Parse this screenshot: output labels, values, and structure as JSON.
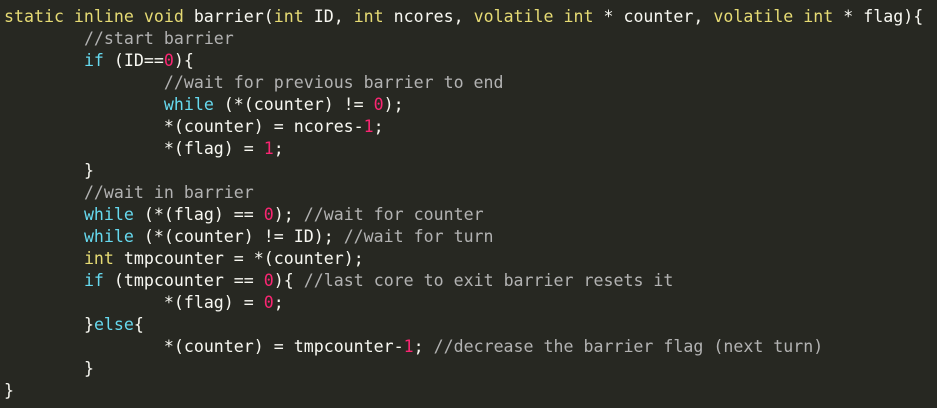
{
  "colors": {
    "background": "#272822",
    "text": "#f8f8f2",
    "keyword": "#e6db74",
    "flow_keyword": "#66d9ef",
    "number": "#f92672",
    "comment": "#b2b2b2"
  },
  "code": [
    {
      "indent": "",
      "tokens": [
        {
          "t": "static inline void",
          "c": "kw"
        },
        {
          "t": " barrier(",
          "c": "ph"
        },
        {
          "t": "int",
          "c": "kw"
        },
        {
          "t": " ID, ",
          "c": "ph"
        },
        {
          "t": "int",
          "c": "kw"
        },
        {
          "t": " ncores, ",
          "c": "ph"
        },
        {
          "t": "volatile int",
          "c": "kw"
        },
        {
          "t": " * counter, ",
          "c": "ph"
        },
        {
          "t": "volatile int",
          "c": "kw"
        },
        {
          "t": " * flag){",
          "c": "ph"
        }
      ]
    },
    {
      "indent": "        ",
      "tokens": [
        {
          "t": "//start barrier",
          "c": "cm"
        }
      ]
    },
    {
      "indent": "        ",
      "tokens": [
        {
          "t": "if",
          "c": "kw2"
        },
        {
          "t": " (ID==",
          "c": "ph"
        },
        {
          "t": "0",
          "c": "num"
        },
        {
          "t": "){",
          "c": "ph"
        }
      ]
    },
    {
      "indent": "                ",
      "tokens": [
        {
          "t": "//wait for previous barrier to end",
          "c": "cm"
        }
      ]
    },
    {
      "indent": "                ",
      "tokens": [
        {
          "t": "while",
          "c": "kw2"
        },
        {
          "t": " (*(counter) != ",
          "c": "ph"
        },
        {
          "t": "0",
          "c": "num"
        },
        {
          "t": ");",
          "c": "ph"
        }
      ]
    },
    {
      "indent": "                ",
      "tokens": [
        {
          "t": "*(counter) = ncores-",
          "c": "ph"
        },
        {
          "t": "1",
          "c": "num"
        },
        {
          "t": ";",
          "c": "ph"
        }
      ]
    },
    {
      "indent": "                ",
      "tokens": [
        {
          "t": "*(flag) = ",
          "c": "ph"
        },
        {
          "t": "1",
          "c": "num"
        },
        {
          "t": ";",
          "c": "ph"
        }
      ]
    },
    {
      "indent": "        ",
      "tokens": [
        {
          "t": "}",
          "c": "ph"
        }
      ]
    },
    {
      "indent": "        ",
      "tokens": [
        {
          "t": "//wait in barrier",
          "c": "cm"
        }
      ]
    },
    {
      "indent": "        ",
      "tokens": [
        {
          "t": "while",
          "c": "kw2"
        },
        {
          "t": " (*(flag) == ",
          "c": "ph"
        },
        {
          "t": "0",
          "c": "num"
        },
        {
          "t": "); ",
          "c": "ph"
        },
        {
          "t": "//wait for counter",
          "c": "cm"
        }
      ]
    },
    {
      "indent": "        ",
      "tokens": [
        {
          "t": "while",
          "c": "kw2"
        },
        {
          "t": " (*(counter) != ID); ",
          "c": "ph"
        },
        {
          "t": "//wait for turn",
          "c": "cm"
        }
      ]
    },
    {
      "indent": "        ",
      "tokens": [
        {
          "t": "int",
          "c": "kw"
        },
        {
          "t": " tmpcounter = *(counter);",
          "c": "ph"
        }
      ]
    },
    {
      "indent": "        ",
      "tokens": [
        {
          "t": "if",
          "c": "kw2"
        },
        {
          "t": " (tmpcounter == ",
          "c": "ph"
        },
        {
          "t": "0",
          "c": "num"
        },
        {
          "t": "){ ",
          "c": "ph"
        },
        {
          "t": "//last core to exit barrier resets it",
          "c": "cm"
        }
      ]
    },
    {
      "indent": "                ",
      "tokens": [
        {
          "t": "*(flag) = ",
          "c": "ph"
        },
        {
          "t": "0",
          "c": "num"
        },
        {
          "t": ";",
          "c": "ph"
        }
      ]
    },
    {
      "indent": "        ",
      "tokens": [
        {
          "t": "}",
          "c": "ph"
        },
        {
          "t": "else",
          "c": "kw2"
        },
        {
          "t": "{",
          "c": "ph"
        }
      ]
    },
    {
      "indent": "                ",
      "tokens": [
        {
          "t": "*(counter) = tmpcounter-",
          "c": "ph"
        },
        {
          "t": "1",
          "c": "num"
        },
        {
          "t": "; ",
          "c": "ph"
        },
        {
          "t": "//decrease the barrier flag (next turn)",
          "c": "cm"
        }
      ]
    },
    {
      "indent": "        ",
      "tokens": [
        {
          "t": "}",
          "c": "ph"
        }
      ]
    },
    {
      "indent": "",
      "tokens": [
        {
          "t": "}",
          "c": "ph"
        }
      ]
    }
  ]
}
